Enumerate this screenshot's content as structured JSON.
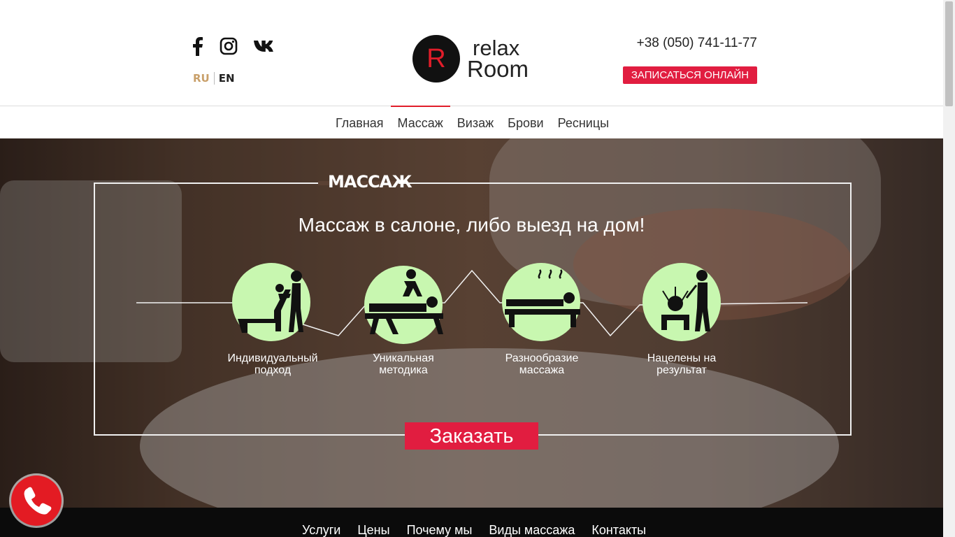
{
  "header": {
    "social": [
      "facebook-icon",
      "instagram-icon",
      "vk-icon"
    ],
    "lang": {
      "ru": "RU",
      "en": "EN"
    },
    "logo": {
      "letter": "R",
      "line1": "relax",
      "line2": "Room"
    },
    "phone": "+38 (050) 741-11-77",
    "book_label": "ЗАПИСАТЬСЯ ОНЛАЙН"
  },
  "nav": {
    "items": [
      "Главная",
      "Массаж",
      "Визаж",
      "Брови",
      "Ресницы"
    ],
    "active": "Массаж"
  },
  "hero": {
    "section_title": "МАССАЖ",
    "heading": "Массаж в салоне, либо выезд на дом!",
    "features": [
      {
        "line1": "Индивидуальный",
        "line2": "подход"
      },
      {
        "line1": "Уникальная",
        "line2": "методика"
      },
      {
        "line1": "Разнообразие",
        "line2": "массажа"
      },
      {
        "line1": "Нацелены на",
        "line2": "результат"
      }
    ],
    "order_label": "Заказать"
  },
  "footer_nav": {
    "items": [
      "Услуги",
      "Цены",
      "Почему мы",
      "Виды массажа",
      "Контакты"
    ]
  },
  "colors": {
    "accent": "#e11d40",
    "icon_fill": "#c8f7b0",
    "lang_active": "#c9a06a"
  }
}
